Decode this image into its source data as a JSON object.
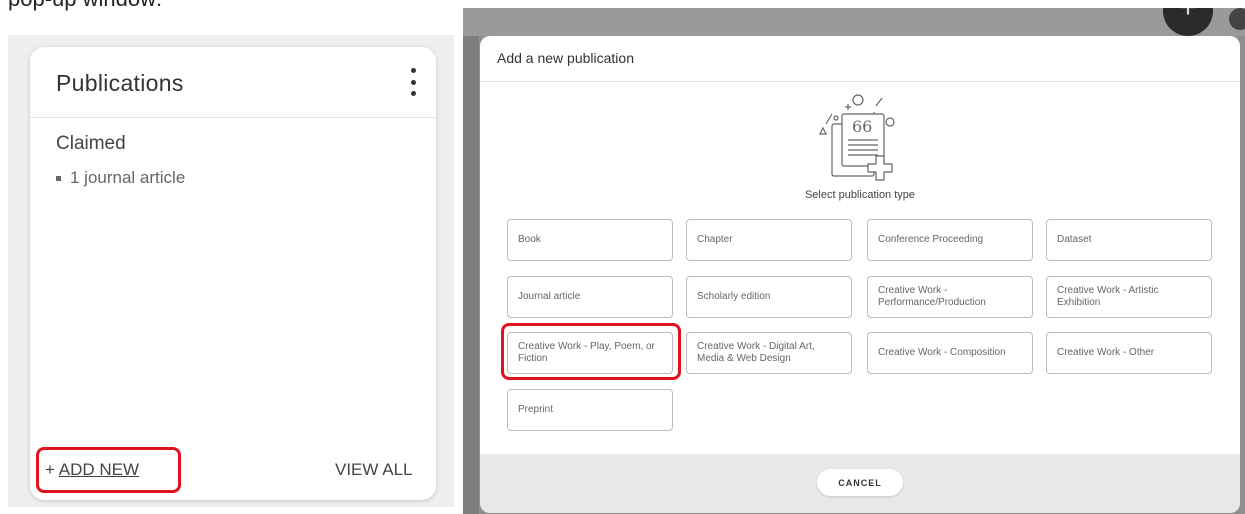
{
  "caption": "pop-up window:",
  "card": {
    "title": "Publications",
    "section_title": "Claimed",
    "section_item": "1 journal article",
    "add_prefix": "+",
    "add_label": "ADD NEW",
    "view_all_label": "VIEW ALL"
  },
  "background_app": {
    "fab_label": "+"
  },
  "modal": {
    "title": "Add a new publication",
    "select_label": "Select publication type",
    "types": [
      "Book",
      "Chapter",
      "Conference Proceeding",
      "Dataset",
      "Journal article",
      "Scholarly edition",
      "Creative Work - Performance/Production",
      "Creative Work - Artistic Exhibition",
      "Creative Work - Play, Poem, or Fiction",
      "Creative Work - Digital Art, Media & Web Design",
      "Creative Work - Composition",
      "Creative Work - Other",
      "Preprint"
    ],
    "cancel_label": "CANCEL"
  },
  "colors": {
    "highlight": "#e0141e",
    "overlay": "#8e8e8e",
    "footer": "#e8e8e8"
  }
}
